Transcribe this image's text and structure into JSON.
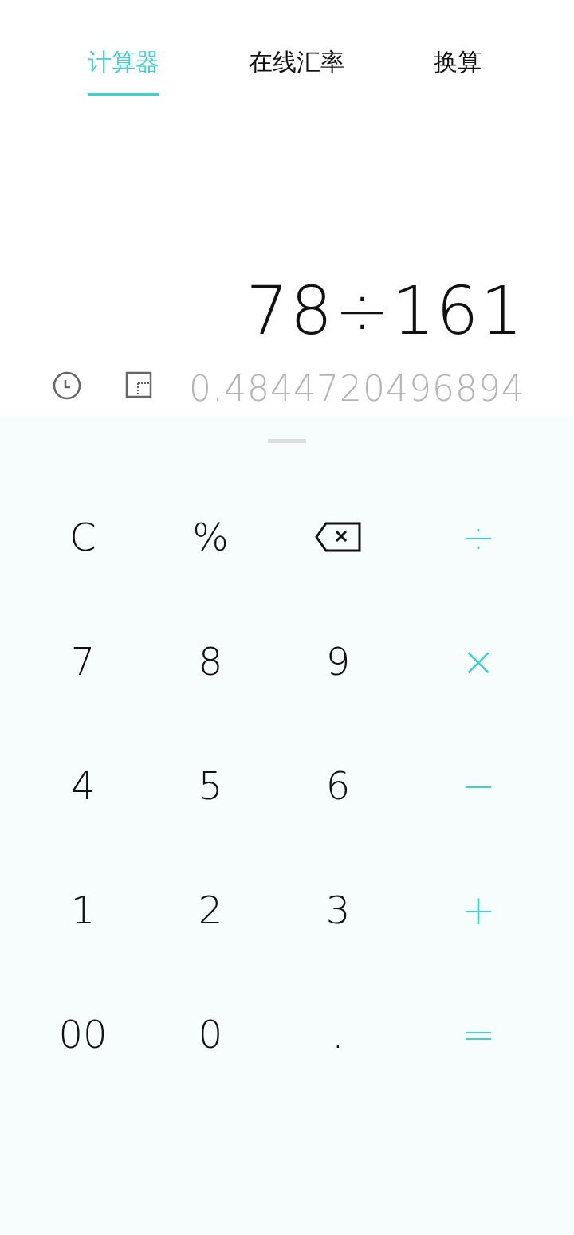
{
  "tabs": [
    {
      "label": "计算器",
      "selected": true
    },
    {
      "label": "在线汇率",
      "selected": false
    },
    {
      "label": "换算",
      "selected": false
    }
  ],
  "display": {
    "expression": "78÷161",
    "result": "0.4844720496894"
  },
  "keypad": {
    "keys": [
      {
        "kind": "text",
        "label": "C"
      },
      {
        "kind": "text",
        "label": "%"
      },
      {
        "kind": "backspace"
      },
      {
        "kind": "operator",
        "label": "÷"
      },
      {
        "kind": "text",
        "label": "7"
      },
      {
        "kind": "text",
        "label": "8"
      },
      {
        "kind": "text",
        "label": "9"
      },
      {
        "kind": "operator",
        "label": "×"
      },
      {
        "kind": "text",
        "label": "4"
      },
      {
        "kind": "text",
        "label": "5"
      },
      {
        "kind": "text",
        "label": "6"
      },
      {
        "kind": "operator",
        "label": "−"
      },
      {
        "kind": "text",
        "label": "1"
      },
      {
        "kind": "text",
        "label": "2"
      },
      {
        "kind": "text",
        "label": "3"
      },
      {
        "kind": "operator",
        "label": "+"
      },
      {
        "kind": "text",
        "label": "00"
      },
      {
        "kind": "text",
        "label": "0"
      },
      {
        "kind": "text",
        "label": "."
      },
      {
        "kind": "operator",
        "label": "="
      }
    ]
  }
}
